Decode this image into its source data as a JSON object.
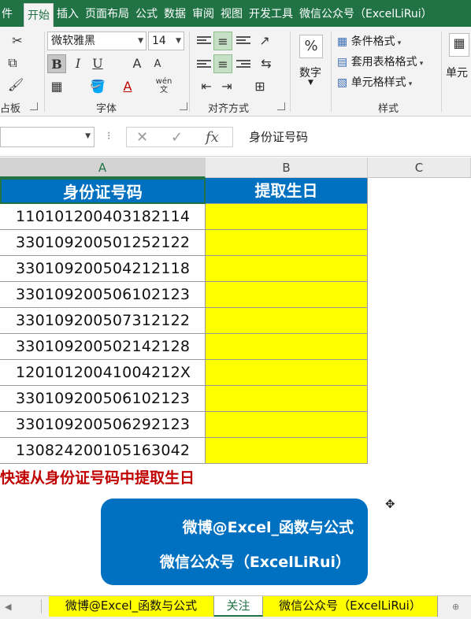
{
  "ribbon_tabs": [
    {
      "label": "件"
    },
    {
      "label": "开始",
      "active": true
    },
    {
      "label": "插入"
    },
    {
      "label": "页面布局"
    },
    {
      "label": "公式"
    },
    {
      "label": "数据"
    },
    {
      "label": "审阅"
    },
    {
      "label": "视图"
    },
    {
      "label": "开发工具"
    },
    {
      "label": "微信公众号（ExcelLiRui）"
    }
  ],
  "ribbon": {
    "clipboard_label": "占板",
    "font_name": "微软雅黑",
    "font_size": "14",
    "bold": "B",
    "italic": "I",
    "underline": "U",
    "grow_font": "A",
    "shrink_font": "A",
    "wen": "wén\n文",
    "font_group_label": "字体",
    "align_group_label": "对齐方式",
    "number_percent": "%",
    "number_label": "数字",
    "cond_format": "条件格式",
    "table_format": "套用表格格式",
    "cell_style": "单元格样式",
    "style_group_label": "样式",
    "cells_label": "单元"
  },
  "formula_bar": {
    "cancel_icon": "✕",
    "enter_icon": "✓",
    "fx": "fx",
    "content": "身份证号码"
  },
  "columns": [
    "A",
    "B",
    "C"
  ],
  "table": {
    "header_a": "身份证号码",
    "header_b": "提取生日",
    "ids": [
      "110101200403182114",
      "330109200501252122",
      "330109200504212118",
      "330109200506102123",
      "330109200507312122",
      "330109200502142128",
      "12010120041004212X",
      "330109200506102123",
      "330109200506292123",
      "130824200105163042"
    ]
  },
  "note": "快速从身份证号码中提取生日",
  "promo": {
    "line1": "微博@Excel_函数与公式",
    "line2": "微信公众号（ExcelLiRui）"
  },
  "sheet_tabs": [
    {
      "label": "微博@Excel_函数与公式"
    },
    {
      "label": "关注",
      "active": true
    },
    {
      "label": "微信公众号（ExcelLiRui）"
    }
  ],
  "colors": {
    "excel_green": "#217346",
    "header_blue": "#0070c0",
    "highlight_yellow": "#ffff00",
    "note_red": "#c00000"
  }
}
